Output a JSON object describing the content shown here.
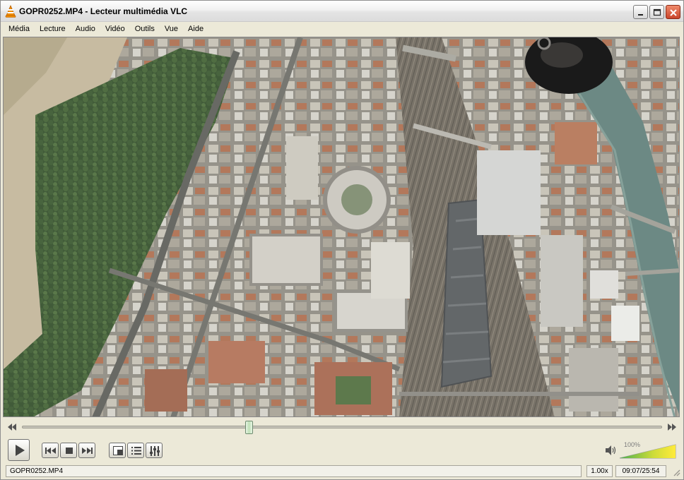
{
  "window": {
    "title": "GOPR0252.MP4 - Lecteur multimédia VLC"
  },
  "menu": {
    "items": [
      "Média",
      "Lecture",
      "Audio",
      "Vidéo",
      "Outils",
      "Vue",
      "Aide"
    ]
  },
  "playback": {
    "progress_fraction": 0.355
  },
  "controls": {
    "icons": [
      "play-icon",
      "previous-icon",
      "stop-icon",
      "next-icon",
      "fullscreen-icon",
      "playlist-icon",
      "extended-settings-icon"
    ]
  },
  "volume": {
    "label": "100%",
    "level_fraction": 1.0
  },
  "status": {
    "filename": "GOPR0252.MP4",
    "speed": "1.00x",
    "time": "09:07/25:54"
  },
  "colors": {
    "accent_green": "#8bc34a",
    "vlc_orange": "#f08c00"
  }
}
